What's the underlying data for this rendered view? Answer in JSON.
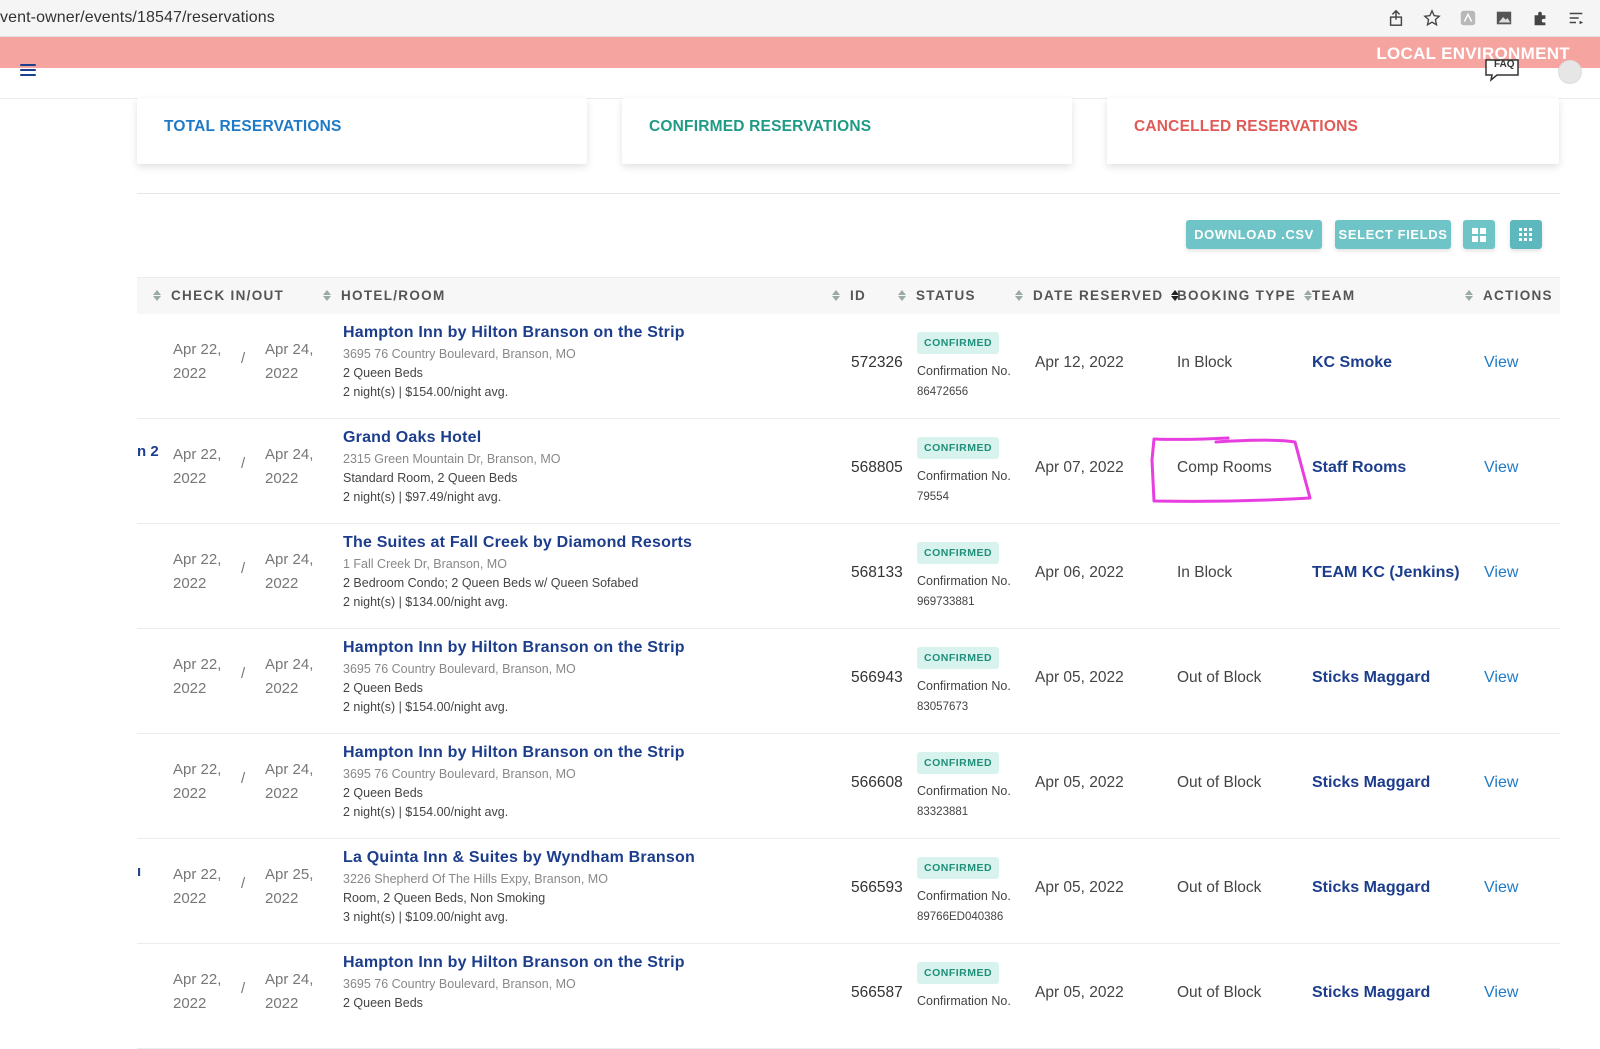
{
  "browser": {
    "url": "vent-owner/events/18547/reservations"
  },
  "env": {
    "label": "LOCAL ENVIRONMENT"
  },
  "header": {
    "faq_label": "FAQ"
  },
  "cards": {
    "total": "TOTAL RESERVATIONS",
    "confirmed": "CONFIRMED RESERVATIONS",
    "cancelled": "CANCELLED RESERVATIONS"
  },
  "toolbar": {
    "download_label": "DOWNLOAD .CSV",
    "fields_label": "SELECT FIELDS"
  },
  "table": {
    "headers": {
      "check": "CHECK IN/OUT",
      "hotel": "HOTEL/ROOM",
      "id": "ID",
      "status": "STATUS",
      "date_reserved": "DATE RESERVED",
      "booking_type": "BOOKING TYPE",
      "team": "TEAM",
      "actions": "ACTIONS"
    },
    "rows": [
      {
        "side": "",
        "check_in": "Apr 22, 2022",
        "check_out": "Apr 24, 2022",
        "hotel": "Hampton Inn by Hilton Branson on the Strip",
        "address": "3695 76 Country Boulevard, Branson, MO",
        "room": "2 Queen Beds",
        "nights": "2 night(s) | $154.00/night avg.",
        "id": "572326",
        "status": "CONFIRMED",
        "conf_label": "Confirmation No.",
        "conf_no": "86472656",
        "date_reserved": "Apr 12, 2022",
        "booking_type": "In Block",
        "team": "KC Smoke",
        "action": "View"
      },
      {
        "side": "n 2",
        "check_in": "Apr 22, 2022",
        "check_out": "Apr 24, 2022",
        "hotel": "Grand Oaks Hotel",
        "address": "2315 Green Mountain Dr, Branson, MO",
        "room": "Standard Room, 2 Queen Beds",
        "nights": "2 night(s) | $97.49/night avg.",
        "id": "568805",
        "status": "CONFIRMED",
        "conf_label": "Confirmation No.",
        "conf_no": "79554",
        "date_reserved": "Apr 07, 2022",
        "booking_type": "Comp Rooms",
        "team": "Staff Rooms",
        "action": "View"
      },
      {
        "side": "",
        "check_in": "Apr 22, 2022",
        "check_out": "Apr 24, 2022",
        "hotel": "The Suites at Fall Creek by Diamond Resorts",
        "address": "1 Fall Creek Dr, Branson, MO",
        "room": "2 Bedroom Condo; 2 Queen Beds w/ Queen Sofabed",
        "nights": "2 night(s) | $134.00/night avg.",
        "id": "568133",
        "status": "CONFIRMED",
        "conf_label": "Confirmation No.",
        "conf_no": "969733881",
        "date_reserved": "Apr 06, 2022",
        "booking_type": "In Block",
        "team": "TEAM KC (Jenkins)",
        "action": "View"
      },
      {
        "side": "",
        "check_in": "Apr 22, 2022",
        "check_out": "Apr 24, 2022",
        "hotel": "Hampton Inn by Hilton Branson on the Strip",
        "address": "3695 76 Country Boulevard, Branson, MO",
        "room": "2 Queen Beds",
        "nights": "2 night(s) | $154.00/night avg.",
        "id": "566943",
        "status": "CONFIRMED",
        "conf_label": "Confirmation No.",
        "conf_no": "83057673",
        "date_reserved": "Apr 05, 2022",
        "booking_type": "Out of Block",
        "team": "Sticks Maggard",
        "action": "View"
      },
      {
        "side": "",
        "check_in": "Apr 22, 2022",
        "check_out": "Apr 24, 2022",
        "hotel": "Hampton Inn by Hilton Branson on the Strip",
        "address": "3695 76 Country Boulevard, Branson, MO",
        "room": "2 Queen Beds",
        "nights": "2 night(s) | $154.00/night avg.",
        "id": "566608",
        "status": "CONFIRMED",
        "conf_label": "Confirmation No.",
        "conf_no": "83323881",
        "date_reserved": "Apr 05, 2022",
        "booking_type": "Out of Block",
        "team": "Sticks Maggard",
        "action": "View"
      },
      {
        "side": "ı",
        "check_in": "Apr 22, 2022",
        "check_out": "Apr 25, 2022",
        "hotel": "La Quinta Inn & Suites by Wyndham Branson",
        "address": "3226 Shepherd Of The Hills Expy, Branson, MO",
        "room": "Room, 2 Queen Beds, Non Smoking",
        "nights": "3 night(s) | $109.00/night avg.",
        "id": "566593",
        "status": "CONFIRMED",
        "conf_label": "Confirmation No.",
        "conf_no": "89766ED040386",
        "date_reserved": "Apr 05, 2022",
        "booking_type": "Out of Block",
        "team": "Sticks Maggard",
        "action": "View"
      },
      {
        "side": "",
        "check_in": "Apr 22, 2022",
        "check_out": "Apr 24, 2022",
        "hotel": "Hampton Inn by Hilton Branson on the Strip",
        "address": "3695 76 Country Boulevard, Branson, MO",
        "room": "2 Queen Beds",
        "nights": "",
        "id": "566587",
        "status": "CONFIRMED",
        "conf_label": "Confirmation No.",
        "conf_no": "",
        "date_reserved": "Apr 05, 2022",
        "booking_type": "Out of Block",
        "team": "Sticks Maggard",
        "action": "View"
      }
    ]
  },
  "colors": {
    "env_banner": "#f6a49f",
    "brand_blue": "#1c3d8c",
    "link_blue": "#1f7ac6",
    "teal_button": "#6fc4c7",
    "confirmed_green": "#1f9a84",
    "cancelled_red": "#e05a57",
    "annotation_magenta": "#e83ee0"
  }
}
